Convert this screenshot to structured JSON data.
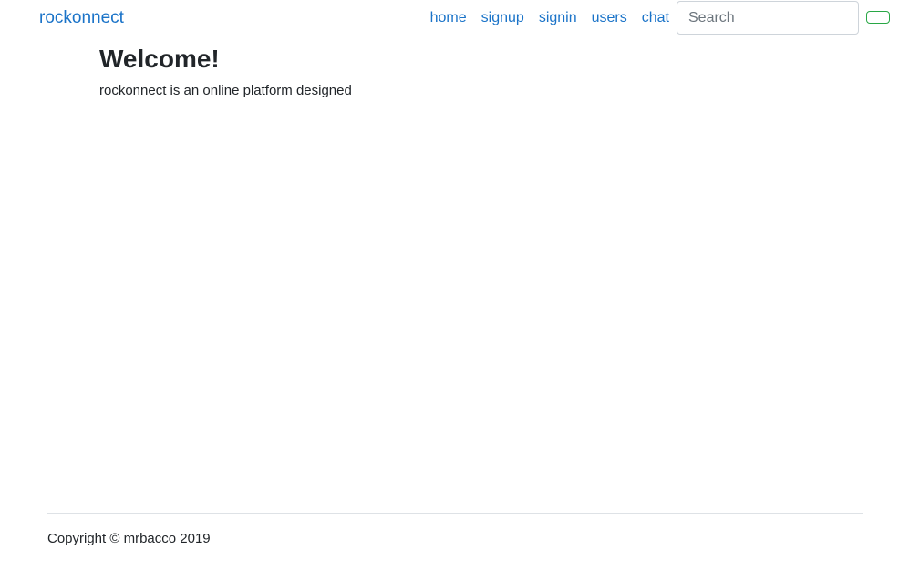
{
  "navbar": {
    "brand": "rockonnect",
    "links": [
      {
        "label": "home"
      },
      {
        "label": "signup"
      },
      {
        "label": "signin"
      },
      {
        "label": "users"
      },
      {
        "label": "chat"
      }
    ],
    "search": {
      "placeholder": "Search",
      "value": ""
    },
    "search_button_label": ""
  },
  "main": {
    "title": "Welcome!",
    "description": "rockonnect is an online platform designed"
  },
  "footer": {
    "copyright": "Copyright © mrbacco 2019"
  },
  "colors": {
    "link": "#1a73c8",
    "text": "#212529",
    "button_border": "#28a745",
    "divider": "#dee2e6"
  }
}
